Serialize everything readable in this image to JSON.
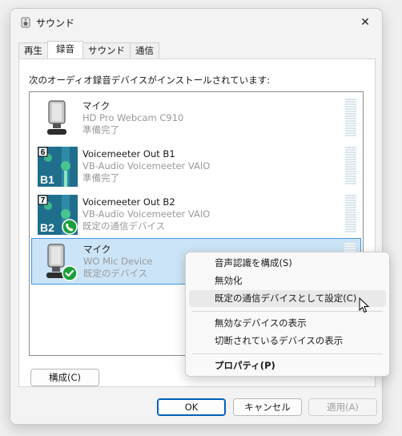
{
  "window": {
    "title": "サウンド",
    "close_glyph": "✕"
  },
  "tabs": [
    {
      "label": "再生",
      "active": false
    },
    {
      "label": "録音",
      "active": true
    },
    {
      "label": "サウンド",
      "active": false
    },
    {
      "label": "通信",
      "active": false
    }
  ],
  "panel": {
    "description": "次のオーディオ録音デバイスがインストールされています:"
  },
  "devices": [
    {
      "name": "マイク",
      "driver": "HD Pro Webcam C910",
      "status": "準備完了",
      "icon": "microphone-icon",
      "badge": "",
      "selected": false
    },
    {
      "name": "Voicemeeter Out B1",
      "driver": "VB-Audio Voicemeeter VAIO",
      "status": "準備完了",
      "icon": "voicemeeter-icon",
      "number": "6",
      "bus": "B1",
      "badge": "",
      "selected": false
    },
    {
      "name": "Voicemeeter Out B2",
      "driver": "VB-Audio Voicemeeter VAIO",
      "status": "既定の通信デバイス",
      "icon": "voicemeeter-icon",
      "number": "7",
      "bus": "B2",
      "badge": "phone-icon",
      "selected": false
    },
    {
      "name": "マイク",
      "driver": "WO Mic Device",
      "status": "既定のデバイス",
      "icon": "microphone-icon",
      "badge": "check-icon",
      "selected": true
    }
  ],
  "buttons": {
    "configure": "構成(C)",
    "ok": "OK",
    "cancel": "キャンセル",
    "apply": "適用(A)"
  },
  "context_menu": {
    "items": [
      {
        "label": "音声認識を構成(S)"
      },
      {
        "label": "無効化"
      },
      {
        "label": "既定の通信デバイスとして設定(C)",
        "hover": true
      },
      {
        "label": "無効なデバイスの表示"
      },
      {
        "label": "切断されているデバイスの表示"
      },
      {
        "label": "プロパティ(P)",
        "bold": true
      }
    ]
  },
  "colors": {
    "accent": "#005fb8",
    "selection": "#cce4f7",
    "voicemeeter_bg": "#1f6e8c",
    "badge_green": "#1e9e3a"
  }
}
